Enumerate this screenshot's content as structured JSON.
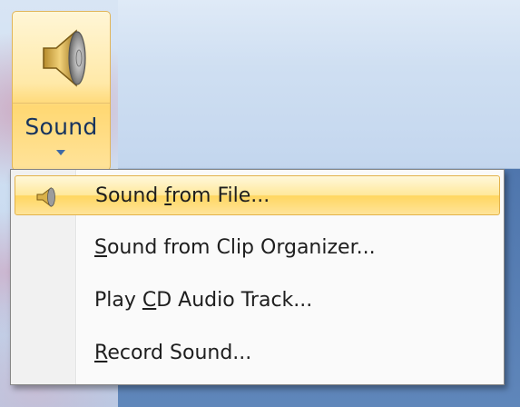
{
  "ribbon": {
    "sound_button": {
      "label": "Sound",
      "icon": "speaker-icon"
    }
  },
  "menu": {
    "items": [
      {
        "pre": "Sound ",
        "accel": "f",
        "post": "rom File...",
        "icon": "speaker-small-icon",
        "highlighted": true
      },
      {
        "pre": "",
        "accel": "S",
        "post": "ound from Clip Organizer...",
        "highlighted": false
      },
      {
        "pre": "Play ",
        "accel": "C",
        "post": "D Audio Track...",
        "highlighted": false
      },
      {
        "pre": "",
        "accel": "R",
        "post": "ecord Sound...",
        "highlighted": false
      }
    ]
  },
  "colors": {
    "highlight": "#ffd660",
    "label_blue": "#16335e",
    "menu_bg": "#fafafa"
  }
}
